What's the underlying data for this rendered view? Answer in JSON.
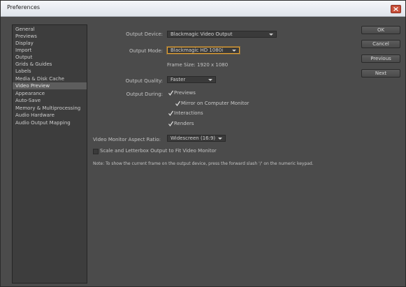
{
  "window": {
    "title": "Preferences"
  },
  "sidebar": {
    "items": [
      {
        "label": "General"
      },
      {
        "label": "Previews"
      },
      {
        "label": "Display"
      },
      {
        "label": "Import"
      },
      {
        "label": "Output"
      },
      {
        "label": "Grids & Guides"
      },
      {
        "label": "Labels"
      },
      {
        "label": "Media & Disk Cache"
      },
      {
        "label": "Video Preview",
        "selected": true
      },
      {
        "label": "Appearance"
      },
      {
        "label": "Auto-Save"
      },
      {
        "label": "Memory & Multiprocessing"
      },
      {
        "label": "Audio Hardware"
      },
      {
        "label": "Audio Output Mapping"
      }
    ]
  },
  "main": {
    "output_device": {
      "label": "Output Device:",
      "value": "Blackmagic Video Output"
    },
    "output_mode": {
      "label": "Output Mode:",
      "value": "Blackmagic HD 1080i"
    },
    "frame_size": "Frame Size: 1920 x 1080",
    "output_quality": {
      "label": "Output Quality:",
      "value": "Faster"
    },
    "output_during": {
      "label": "Output During:",
      "previews": "Previews",
      "mirror": "Mirror on Computer Monitor",
      "interactions": "Interactions",
      "renders": "Renders"
    },
    "aspect_ratio": {
      "label": "Video Monitor Aspect Ratio:",
      "value": "Widescreen (16:9)"
    },
    "scale_letterbox": "Scale and Letterbox Output to Fit Video Monitor",
    "note": "Note: To show the current frame on the output device, press the forward slash '/' on the numeric keypad."
  },
  "buttons": {
    "ok": "OK",
    "cancel": "Cancel",
    "previous": "Previous",
    "next": "Next"
  }
}
